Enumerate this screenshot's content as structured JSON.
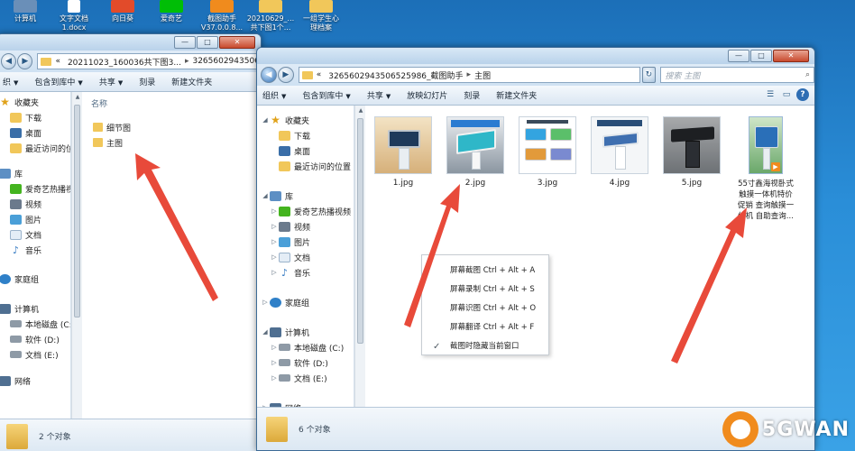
{
  "desktop": {
    "icons": [
      {
        "label": "计算机"
      },
      {
        "label": "文字文档\n1.docx"
      },
      {
        "label": "向日葵"
      },
      {
        "label": "爱奇艺"
      },
      {
        "label": "截图助手\nV37.0.0.8..."
      },
      {
        "label": "20210629_...\n共下图1个..."
      },
      {
        "label": "一组学生心\n理档案"
      }
    ]
  },
  "left_window": {
    "address": {
      "sep": "«",
      "part1": "20211023_160036共下图3...",
      "arrow": "▸",
      "part2": "3265602943506525986"
    },
    "toolbar": [
      "织",
      "包含到库中",
      "共享",
      "刻录",
      "新建文件夹"
    ],
    "nav": {
      "favorites": "收藏夹",
      "downloads": "下载",
      "desktop": "桌面",
      "recent": "最近访问的位置",
      "library": "库",
      "aiqiyi": "爱奇艺热播视频",
      "videos": "视频",
      "pictures": "图片",
      "documents": "文档",
      "music": "音乐",
      "homegroup": "家庭组",
      "computer": "计算机",
      "drive_c": "本地磁盘 (C:)",
      "drive_d": "软件 (D:)",
      "drive_e": "文档 (E:)",
      "network": "网络"
    },
    "column_header": "名称",
    "files": [
      "细节图",
      "主图"
    ],
    "status": "2 个对象"
  },
  "right_window": {
    "address": {
      "sep": "«",
      "part1": "3265602943506525986_截图助手",
      "arrow": "▸",
      "part2": "主图"
    },
    "search_placeholder": "搜索 主图",
    "controls": {
      "min": "—",
      "max": "□",
      "close": "✕"
    },
    "toolbar": [
      "组织",
      "包含到库中",
      "共享",
      "放映幻灯片",
      "刻录",
      "新建文件夹"
    ],
    "nav": {
      "favorites": "收藏夹",
      "downloads": "下载",
      "desktop": "桌面",
      "recent": "最近访问的位置",
      "library": "库",
      "aiqiyi": "爱奇艺热播视频",
      "videos": "视频",
      "pictures": "图片",
      "documents": "文档",
      "music": "音乐",
      "homegroup": "家庭组",
      "computer": "计算机",
      "drive_c": "本地磁盘 (C:)",
      "drive_d": "软件 (D:)",
      "drive_e": "文档 (E:)",
      "network": "网络"
    },
    "thumbnails": [
      {
        "label": "1.jpg"
      },
      {
        "label": "2.jpg"
      },
      {
        "label": "3.jpg"
      },
      {
        "label": "4.jpg"
      },
      {
        "label": "5.jpg"
      },
      {
        "label": "55寸鑫海视卧式\n触摸一体机特价\n促销 查询触摸一\n体机 自助查询..."
      }
    ],
    "status": "6 个对象"
  },
  "context_menu": {
    "items": [
      "屏幕截图 Ctrl + Alt + A",
      "屏幕录制 Ctrl + Alt + S",
      "屏幕识图 Ctrl + Alt + O",
      "屏幕翻译 Ctrl + Alt + F",
      "截图时隐藏当前窗口"
    ]
  },
  "watermark": {
    "text": "5GWAN"
  },
  "colors": {
    "arrow": "#e84a3a",
    "accent": "#f08b1d",
    "desktop": "#2a8ed8"
  }
}
